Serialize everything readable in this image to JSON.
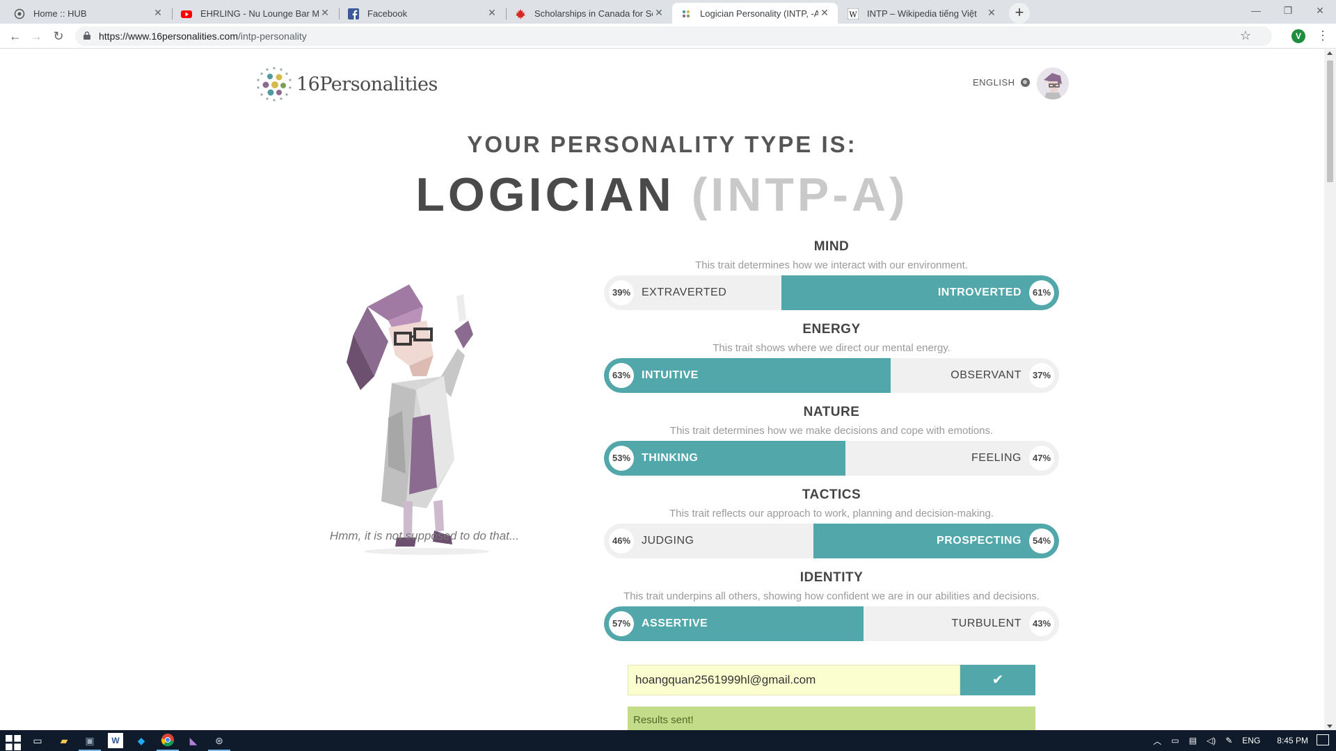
{
  "browser": {
    "tabs": [
      {
        "title": "Home :: HUB",
        "icon": "hub-icon",
        "active": false
      },
      {
        "title": "EHRLING - Nu Lounge Bar Music",
        "icon": "youtube-icon",
        "active": false
      },
      {
        "title": "Facebook",
        "icon": "facebook-icon",
        "active": false
      },
      {
        "title": "Scholarships in Canada for South",
        "icon": "maple-leaf-icon",
        "active": false
      },
      {
        "title": "Logician Personality (INTP, -A/-T)",
        "icon": "16p-icon",
        "active": true
      },
      {
        "title": "INTP – Wikipedia tiếng Việt",
        "icon": "wikipedia-icon",
        "active": false
      }
    ],
    "url_host": "https://www.16personalities.com",
    "url_path": "/intp-personality",
    "profile_initial": "V"
  },
  "header": {
    "logo_text": "16Personalities",
    "language": "ENGLISH"
  },
  "result": {
    "subtitle": "YOUR PERSONALITY TYPE IS:",
    "type_name": "LOGICIAN",
    "type_code": "(INTP-A)",
    "caption": "Hmm, it is not supposed to do that..."
  },
  "traits": [
    {
      "name": "MIND",
      "description": "This trait determines how we interact with our environment.",
      "left_label": "EXTRAVERTED",
      "left_pct": "39%",
      "right_label": "INTROVERTED",
      "right_pct": "61%",
      "dominant": "right",
      "dominant_value": 0.61
    },
    {
      "name": "ENERGY",
      "description": "This trait shows where we direct our mental energy.",
      "left_label": "INTUITIVE",
      "left_pct": "63%",
      "right_label": "OBSERVANT",
      "right_pct": "37%",
      "dominant": "left",
      "dominant_value": 0.63
    },
    {
      "name": "NATURE",
      "description": "This trait determines how we make decisions and cope with emotions.",
      "left_label": "THINKING",
      "left_pct": "53%",
      "right_label": "FEELING",
      "right_pct": "47%",
      "dominant": "left",
      "dominant_value": 0.53
    },
    {
      "name": "TACTICS",
      "description": "This trait reflects our approach to work, planning and decision-making.",
      "left_label": "JUDGING",
      "left_pct": "46%",
      "right_label": "PROSPECTING",
      "right_pct": "54%",
      "dominant": "right",
      "dominant_value": 0.54
    },
    {
      "name": "IDENTITY",
      "description": "This trait underpins all others, showing how confident we are in our abilities and decisions.",
      "left_label": "ASSERTIVE",
      "left_pct": "57%",
      "right_label": "TURBULENT",
      "right_pct": "43%",
      "dominant": "left",
      "dominant_value": 0.57
    }
  ],
  "email": {
    "value": "hoangquan2561999hl@gmail.com",
    "submit_icon": "checkmark-icon",
    "status": "Results sent!"
  },
  "taskbar": {
    "language": "ENG",
    "time": "8:45 PM"
  },
  "colors": {
    "accent": "#51a7a9",
    "bar_bg": "#f0f0f0",
    "email_bg": "#fbffd0",
    "success_bg": "#c3dc8a"
  }
}
